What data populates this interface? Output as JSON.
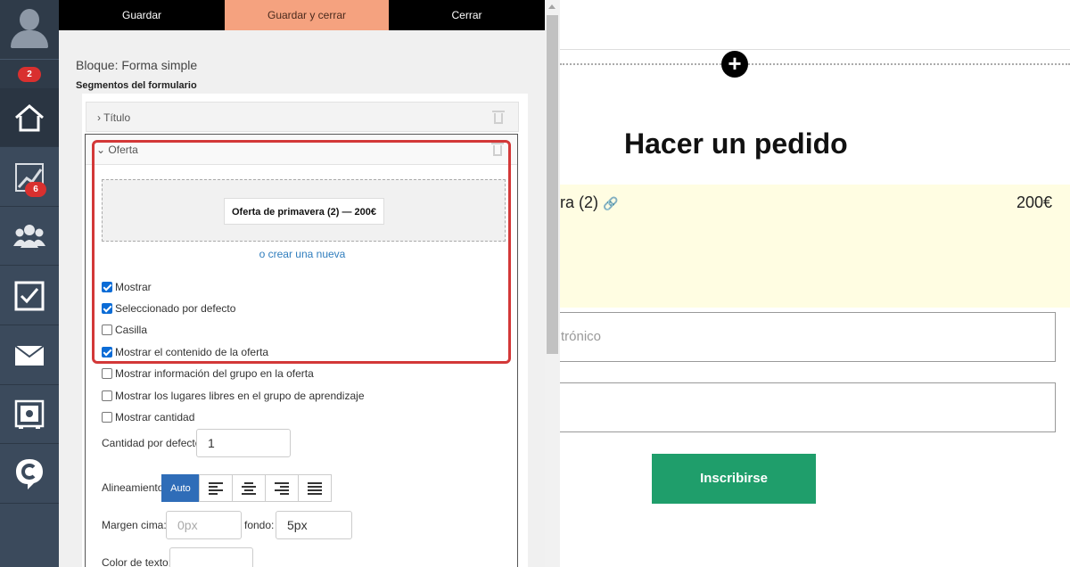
{
  "nav": {
    "notifications_count": "2",
    "items": [
      {
        "icon": "home-icon"
      },
      {
        "icon": "chart-icon",
        "badge": "6"
      },
      {
        "icon": "users-icon"
      },
      {
        "icon": "tasks-icon"
      },
      {
        "icon": "mail-icon"
      },
      {
        "icon": "safe-icon"
      },
      {
        "icon": "brand-icon"
      }
    ]
  },
  "toolbar": {
    "save_label": "Guardar",
    "save_close_label": "Guardar y cerrar",
    "close_label": "Cerrar"
  },
  "editor": {
    "block_title": "Bloque: Forma simple",
    "segments_title": "Segmentos del formulario",
    "segments": [
      {
        "label": "Título",
        "expanded": false
      },
      {
        "label": "Oferta",
        "expanded": true
      }
    ],
    "offer_chip": "Oferta de primavera (2) — 200€",
    "create_new_link": "o crear una nueva",
    "checkboxes": [
      {
        "label": "Mostrar",
        "checked": true
      },
      {
        "label": "Seleccionado por defecto",
        "checked": true
      },
      {
        "label": "Casilla",
        "checked": false
      },
      {
        "label": "Mostrar el contenido de la oferta",
        "checked": true
      },
      {
        "label": "Mostrar información del grupo en la oferta",
        "checked": false
      },
      {
        "label": "Mostrar los lugares libres en el grupo de aprendizaje",
        "checked": false
      },
      {
        "label": "Mostrar cantidad",
        "checked": false
      }
    ],
    "default_qty_label": "Cantidad por defecto",
    "default_qty_value": "1",
    "alignment_label": "Alineamiento",
    "alignment_auto": "Auto",
    "margin_top_label": "Margen cima:",
    "margin_top_placeholder": "0px",
    "margin_bottom_label": "fondo:",
    "margin_bottom_value": "5px",
    "text_color_label": "Color de texto:"
  },
  "preview": {
    "title": "Hacer un pedido",
    "offer_name_partial": "ra (2)",
    "offer_price": "200€",
    "email_placeholder_partial": "trónico",
    "submit_label": "Inscribirse"
  },
  "colors": {
    "accent_save_close": "#f5a27f",
    "submit_green": "#1f9e6b",
    "highlight_red": "#d33838",
    "link_blue": "#2f7dbd"
  }
}
